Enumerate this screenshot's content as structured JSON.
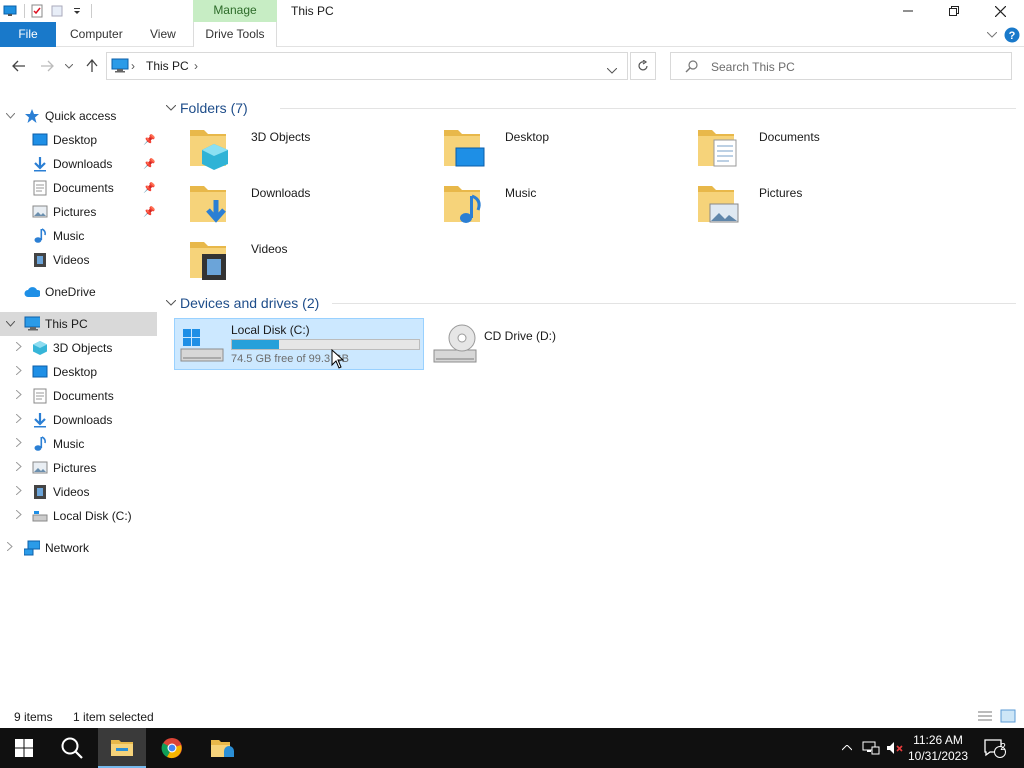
{
  "window": {
    "title": "This PC",
    "manage_label": "Manage",
    "min_icon": "minimize-icon",
    "max_icon": "restore-icon",
    "close_icon": "close-icon"
  },
  "ribbon": {
    "file": "File",
    "computer": "Computer",
    "view": "View",
    "drive_tools": "Drive Tools"
  },
  "address": {
    "crumb": "This PC",
    "search_placeholder": "Search This PC"
  },
  "sidebar": {
    "items": [
      {
        "label": "Quick access",
        "icon": "star-icon",
        "pinned": false
      },
      {
        "label": "Desktop",
        "icon": "desktop-icon",
        "pinned": true
      },
      {
        "label": "Downloads",
        "icon": "downloads-icon",
        "pinned": true
      },
      {
        "label": "Documents",
        "icon": "documents-icon",
        "pinned": true
      },
      {
        "label": "Pictures",
        "icon": "pictures-icon",
        "pinned": true
      },
      {
        "label": "Music",
        "icon": "music-icon",
        "pinned": false
      },
      {
        "label": "Videos",
        "icon": "videos-icon",
        "pinned": false
      },
      {
        "label": "OneDrive",
        "icon": "onedrive-icon",
        "pinned": false
      },
      {
        "label": "This PC",
        "icon": "pc-icon",
        "pinned": false,
        "selected": true
      },
      {
        "label": "3D Objects",
        "icon": "3d-objects-icon",
        "pinned": false
      },
      {
        "label": "Desktop",
        "icon": "desktop-icon",
        "pinned": false
      },
      {
        "label": "Documents",
        "icon": "documents-icon",
        "pinned": false
      },
      {
        "label": "Downloads",
        "icon": "downloads-icon",
        "pinned": false
      },
      {
        "label": "Music",
        "icon": "music-icon",
        "pinned": false
      },
      {
        "label": "Pictures",
        "icon": "pictures-icon",
        "pinned": false
      },
      {
        "label": "Videos",
        "icon": "videos-icon",
        "pinned": false
      },
      {
        "label": "Local Disk (C:)",
        "icon": "drive-icon",
        "pinned": false
      },
      {
        "label": "Network",
        "icon": "network-icon",
        "pinned": false
      }
    ]
  },
  "content": {
    "folders_header": "Folders (7)",
    "folders": [
      {
        "label": "3D Objects",
        "icon": "3d-objects-folder-icon"
      },
      {
        "label": "Desktop",
        "icon": "desktop-folder-icon"
      },
      {
        "label": "Documents",
        "icon": "documents-folder-icon"
      },
      {
        "label": "Downloads",
        "icon": "downloads-folder-icon"
      },
      {
        "label": "Music",
        "icon": "music-folder-icon"
      },
      {
        "label": "Pictures",
        "icon": "pictures-folder-icon"
      },
      {
        "label": "Videos",
        "icon": "videos-folder-icon"
      }
    ],
    "drives_header": "Devices and drives (2)",
    "drives": [
      {
        "label": "Local Disk (C:)",
        "free_text": "74.5 GB free of 99.3 GB",
        "used_fraction": 0.25,
        "selected": true,
        "icon": "windows-drive-icon"
      },
      {
        "label": "CD Drive (D:)",
        "icon": "cd-drive-icon",
        "selected": false
      }
    ]
  },
  "status": {
    "items_count": "9 items",
    "selection": "1 item selected"
  },
  "taskbar": {
    "time": "11:26 AM",
    "date": "10/31/2023",
    "notification_count": "2"
  },
  "colors": {
    "accent": "#1979ca",
    "selection": "#cce8ff",
    "manage_tab": "#c7edc4",
    "drive_bar": "#26a0da"
  }
}
